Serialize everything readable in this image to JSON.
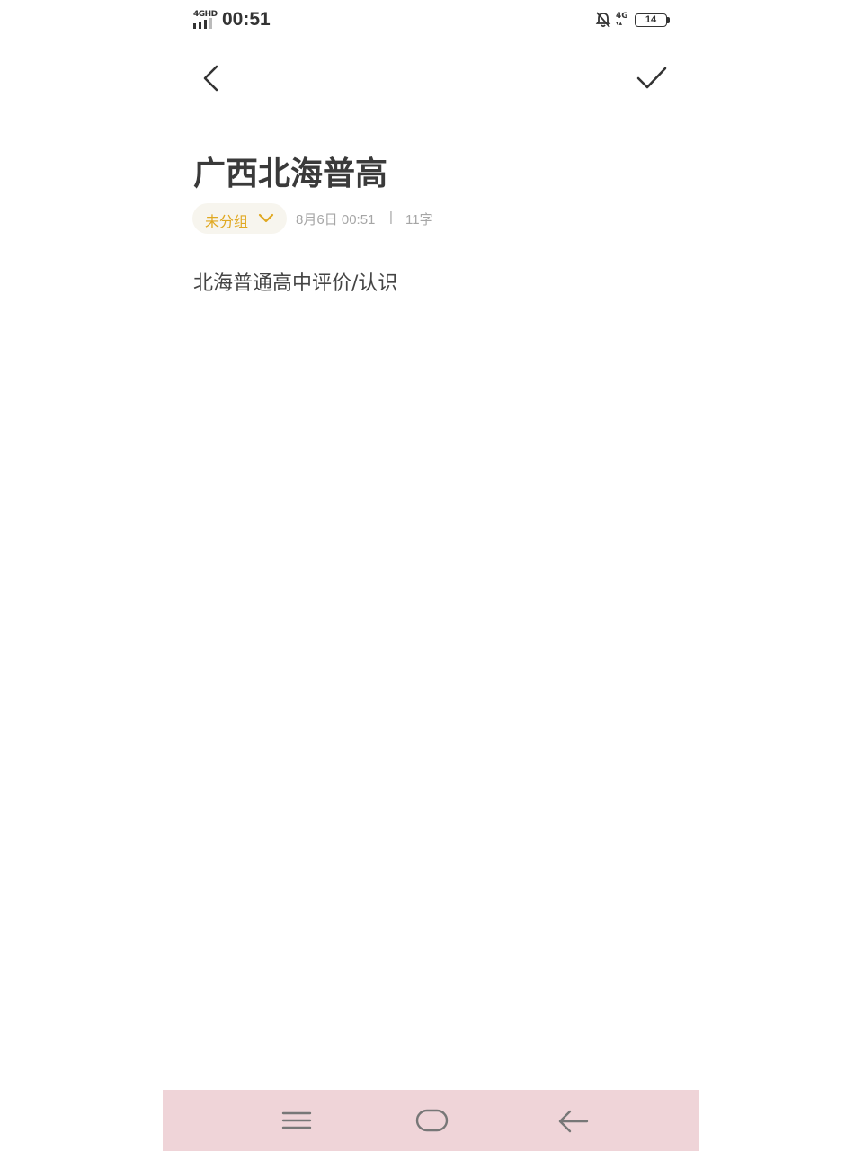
{
  "status_bar": {
    "network_label": "4GHD",
    "time": "00:51",
    "network_label_right": "4G",
    "battery_level": "14",
    "icons": [
      "signal-icon",
      "bell-off-icon",
      "battery-icon"
    ]
  },
  "toolbar": {
    "back_icon": "chevron-left-icon",
    "save_icon": "checkmark-icon"
  },
  "note": {
    "title": "广西北海普高",
    "group": "未分组",
    "date": "8月6日 00:51",
    "separator": "|",
    "word_count": "11字",
    "body": "北海普通高中评价/认识"
  },
  "nav_bar": {
    "icons": [
      "menu-icon",
      "home-icon",
      "back-arrow-icon"
    ]
  },
  "colors": {
    "accent": "#e0a821",
    "chip_bg": "#f7f5ee",
    "nav_bg": "#efd4d8",
    "title": "#3a3a3a",
    "meta": "#a6a6a6"
  }
}
